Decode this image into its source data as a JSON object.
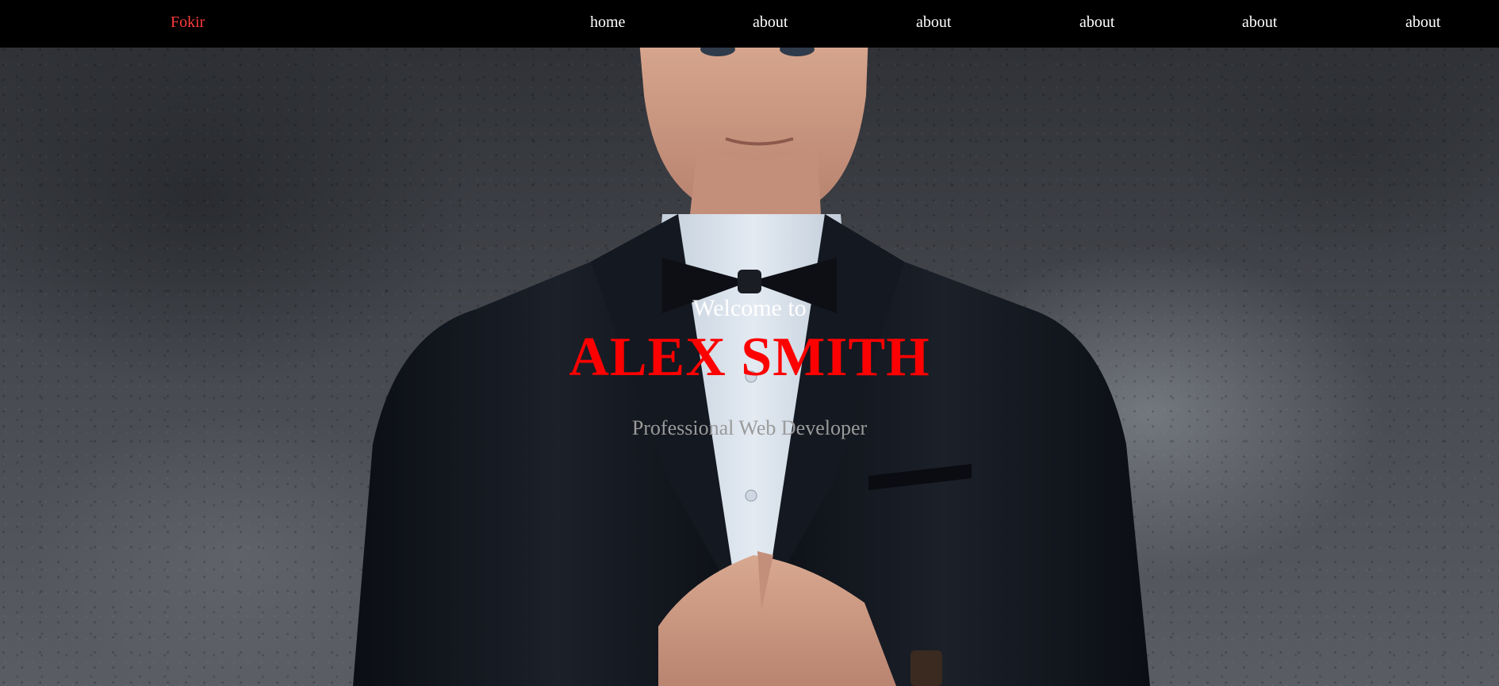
{
  "nav": {
    "brand": "Fokir",
    "items": [
      {
        "label": "home"
      },
      {
        "label": "about"
      },
      {
        "label": "about"
      },
      {
        "label": "about"
      },
      {
        "label": "about"
      },
      {
        "label": "about"
      }
    ]
  },
  "hero": {
    "welcome": "Welcome to",
    "name": "ALEX SMITH",
    "tagline": "Professional Web Developer"
  },
  "colors": {
    "nav_background": "#000000",
    "brand": "#ff3b3b",
    "name_accent": "#ff0000",
    "tagline": "#9a9a9a"
  }
}
